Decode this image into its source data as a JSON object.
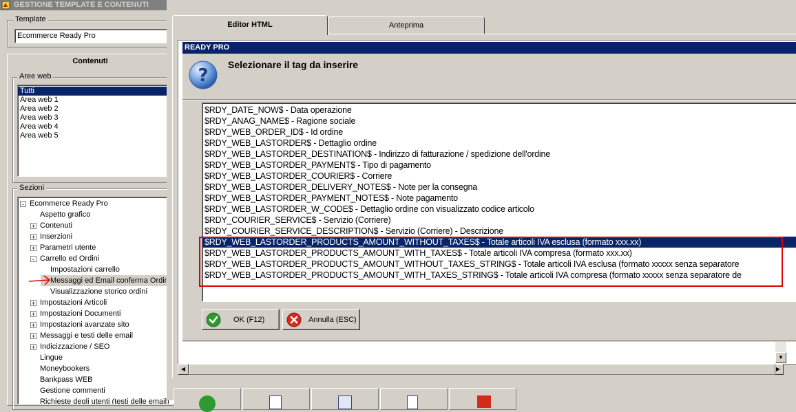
{
  "left_panel": {
    "title": "GESTIONE TEMPLATE E CONTENUTI",
    "template_label": "Template",
    "template_value": "Ecommerce Ready Pro",
    "contenuti_label": "Contenuti",
    "aree_web_label": "Aree web",
    "aree_web": [
      "Tutti",
      "Area web 1",
      "Area web 2",
      "Area web 3",
      "Area web 4",
      "Area web 5"
    ],
    "sezioni_label": "Sezioni",
    "tree": [
      {
        "label": "Ecommerce Ready Pro",
        "level": 0,
        "exp": "-"
      },
      {
        "label": "Aspetto grafico",
        "level": 1,
        "exp": ""
      },
      {
        "label": "Contenuti",
        "level": 1,
        "exp": "+"
      },
      {
        "label": "Inserzioni",
        "level": 1,
        "exp": "+"
      },
      {
        "label": "Parametri utente",
        "level": 1,
        "exp": "+"
      },
      {
        "label": "Carrello ed Ordini",
        "level": 1,
        "exp": "-"
      },
      {
        "label": "Impostazioni carrello",
        "level": 2,
        "exp": ""
      },
      {
        "label": "Messaggi ed Email conferma Ordine",
        "level": 2,
        "exp": "",
        "selected": true
      },
      {
        "label": "Visualizzazione storico ordini",
        "level": 2,
        "exp": ""
      },
      {
        "label": "Impostazioni Articoli",
        "level": 1,
        "exp": "+"
      },
      {
        "label": "Impostazioni Documenti",
        "level": 1,
        "exp": "+"
      },
      {
        "label": "Impostazioni avanzate sito",
        "level": 1,
        "exp": "+"
      },
      {
        "label": "Messaggi e testi delle email",
        "level": 1,
        "exp": "+"
      },
      {
        "label": "Indicizzazione / SEO",
        "level": 1,
        "exp": "+"
      },
      {
        "label": "Lingue",
        "level": 1,
        "exp": ""
      },
      {
        "label": "Moneybookers",
        "level": 1,
        "exp": ""
      },
      {
        "label": "Bankpass WEB",
        "level": 1,
        "exp": ""
      },
      {
        "label": "Gestione commenti",
        "level": 1,
        "exp": ""
      },
      {
        "label": "Richieste degli utenti (testi delle email)",
        "level": 1,
        "exp": ""
      }
    ]
  },
  "tabs": [
    {
      "label": "Editor HTML",
      "active": true
    },
    {
      "label": "Anteprima",
      "active": false
    }
  ],
  "dialog": {
    "title": "READY PRO",
    "icon": "question-icon",
    "prompt": "Selezionare il tag da inserire",
    "items": [
      "$RDY_DATE_NOW$ - Data operazione",
      "$RDY_ANAG_NAME$ - Ragione sociale",
      "$RDY_WEB_ORDER_ID$ - Id ordine",
      "$RDY_WEB_LASTORDER$ - Dettaglio ordine",
      "$RDY_WEB_LASTORDER_DESTINATION$ - Indirizzo di fatturazione / spedizione dell'ordine",
      "$RDY_WEB_LASTORDER_PAYMENT$ - Tipo di pagamento",
      "$RDY_WEB_LASTORDER_COURIER$ - Corriere",
      "$RDY_WEB_LASTORDER_DELIVERY_NOTES$ - Note per la consegna",
      "$RDY_WEB_LASTORDER_PAYMENT_NOTES$ - Note pagamento",
      "$RDY_WEB_LASTORDER_W_CODE$ - Dettaglio ordine con visualizzato codice articolo",
      "$RDY_COURIER_SERVICE$ - Servizio (Corriere)",
      "$RDY_COURIER_SERVICE_DESCRIPTION$ - Servizio (Corriere) - Descrizione",
      "$RDY_WEB_LASTORDER_PRODUCTS_AMOUNT_WITHOUT_TAXES$ - Totale articoli IVA esclusa (formato xxx.xx)",
      "$RDY_WEB_LASTORDER_PRODUCTS_AMOUNT_WITH_TAXES$ - Totale articoli IVA compresa (formato xxx.xx)",
      "$RDY_WEB_LASTORDER_PRODUCTS_AMOUNT_WITHOUT_TAXES_STRING$ - Totale articoli IVA esclusa (formato xxxxx senza separatore",
      "$RDY_WEB_LASTORDER_PRODUCTS_AMOUNT_WITH_TAXES_STRING$ - Totale articoli IVA compresa (formato xxxxx senza separatore de"
    ],
    "selected_index": 12,
    "ok_label": "OK (F12)",
    "cancel_label": "Annulla (ESC)"
  },
  "colors": {
    "highlight": "#0a246a",
    "annotation_red": "#e00000",
    "ok_green": "#2e9a2e",
    "cancel_red": "#d42a1c"
  }
}
